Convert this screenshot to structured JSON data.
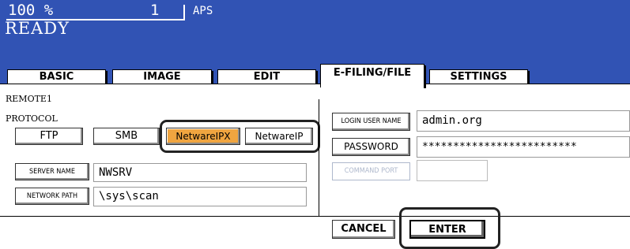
{
  "header": {
    "copies_value": "100 %",
    "copy_count": "1",
    "paper_mode": "APS",
    "status": "READY"
  },
  "tabs": [
    {
      "label": "BASIC",
      "active": false
    },
    {
      "label": "IMAGE",
      "active": false
    },
    {
      "label": "EDIT",
      "active": false
    },
    {
      "label": "E-FILING/FILE",
      "active": true
    },
    {
      "label": "SETTINGS",
      "active": false
    }
  ],
  "remote": {
    "title": "REMOTE1",
    "protocol_label": "PROTOCOL",
    "protocols": [
      {
        "label": "FTP",
        "selected": false
      },
      {
        "label": "SMB",
        "selected": false
      },
      {
        "label": "NetwareIPX",
        "selected": true
      },
      {
        "label": "NetwareIP",
        "selected": false
      }
    ],
    "server_name_label": "SERVER NAME",
    "server_name_value": "NWSRV",
    "network_path_label": "NETWORK PATH",
    "network_path_value": "\\sys\\scan",
    "login_user_label": "LOGIN USER NAME",
    "login_user_value": "admin.org",
    "password_label": "PASSWORD",
    "password_value": "*************************",
    "command_port_label": "COMMAND PORT",
    "command_port_value": ""
  },
  "actions": {
    "cancel_label": "CANCEL",
    "enter_label": "ENTER"
  },
  "colors": {
    "header_bg": "#3153b4",
    "selected_button": "#f0a540"
  }
}
